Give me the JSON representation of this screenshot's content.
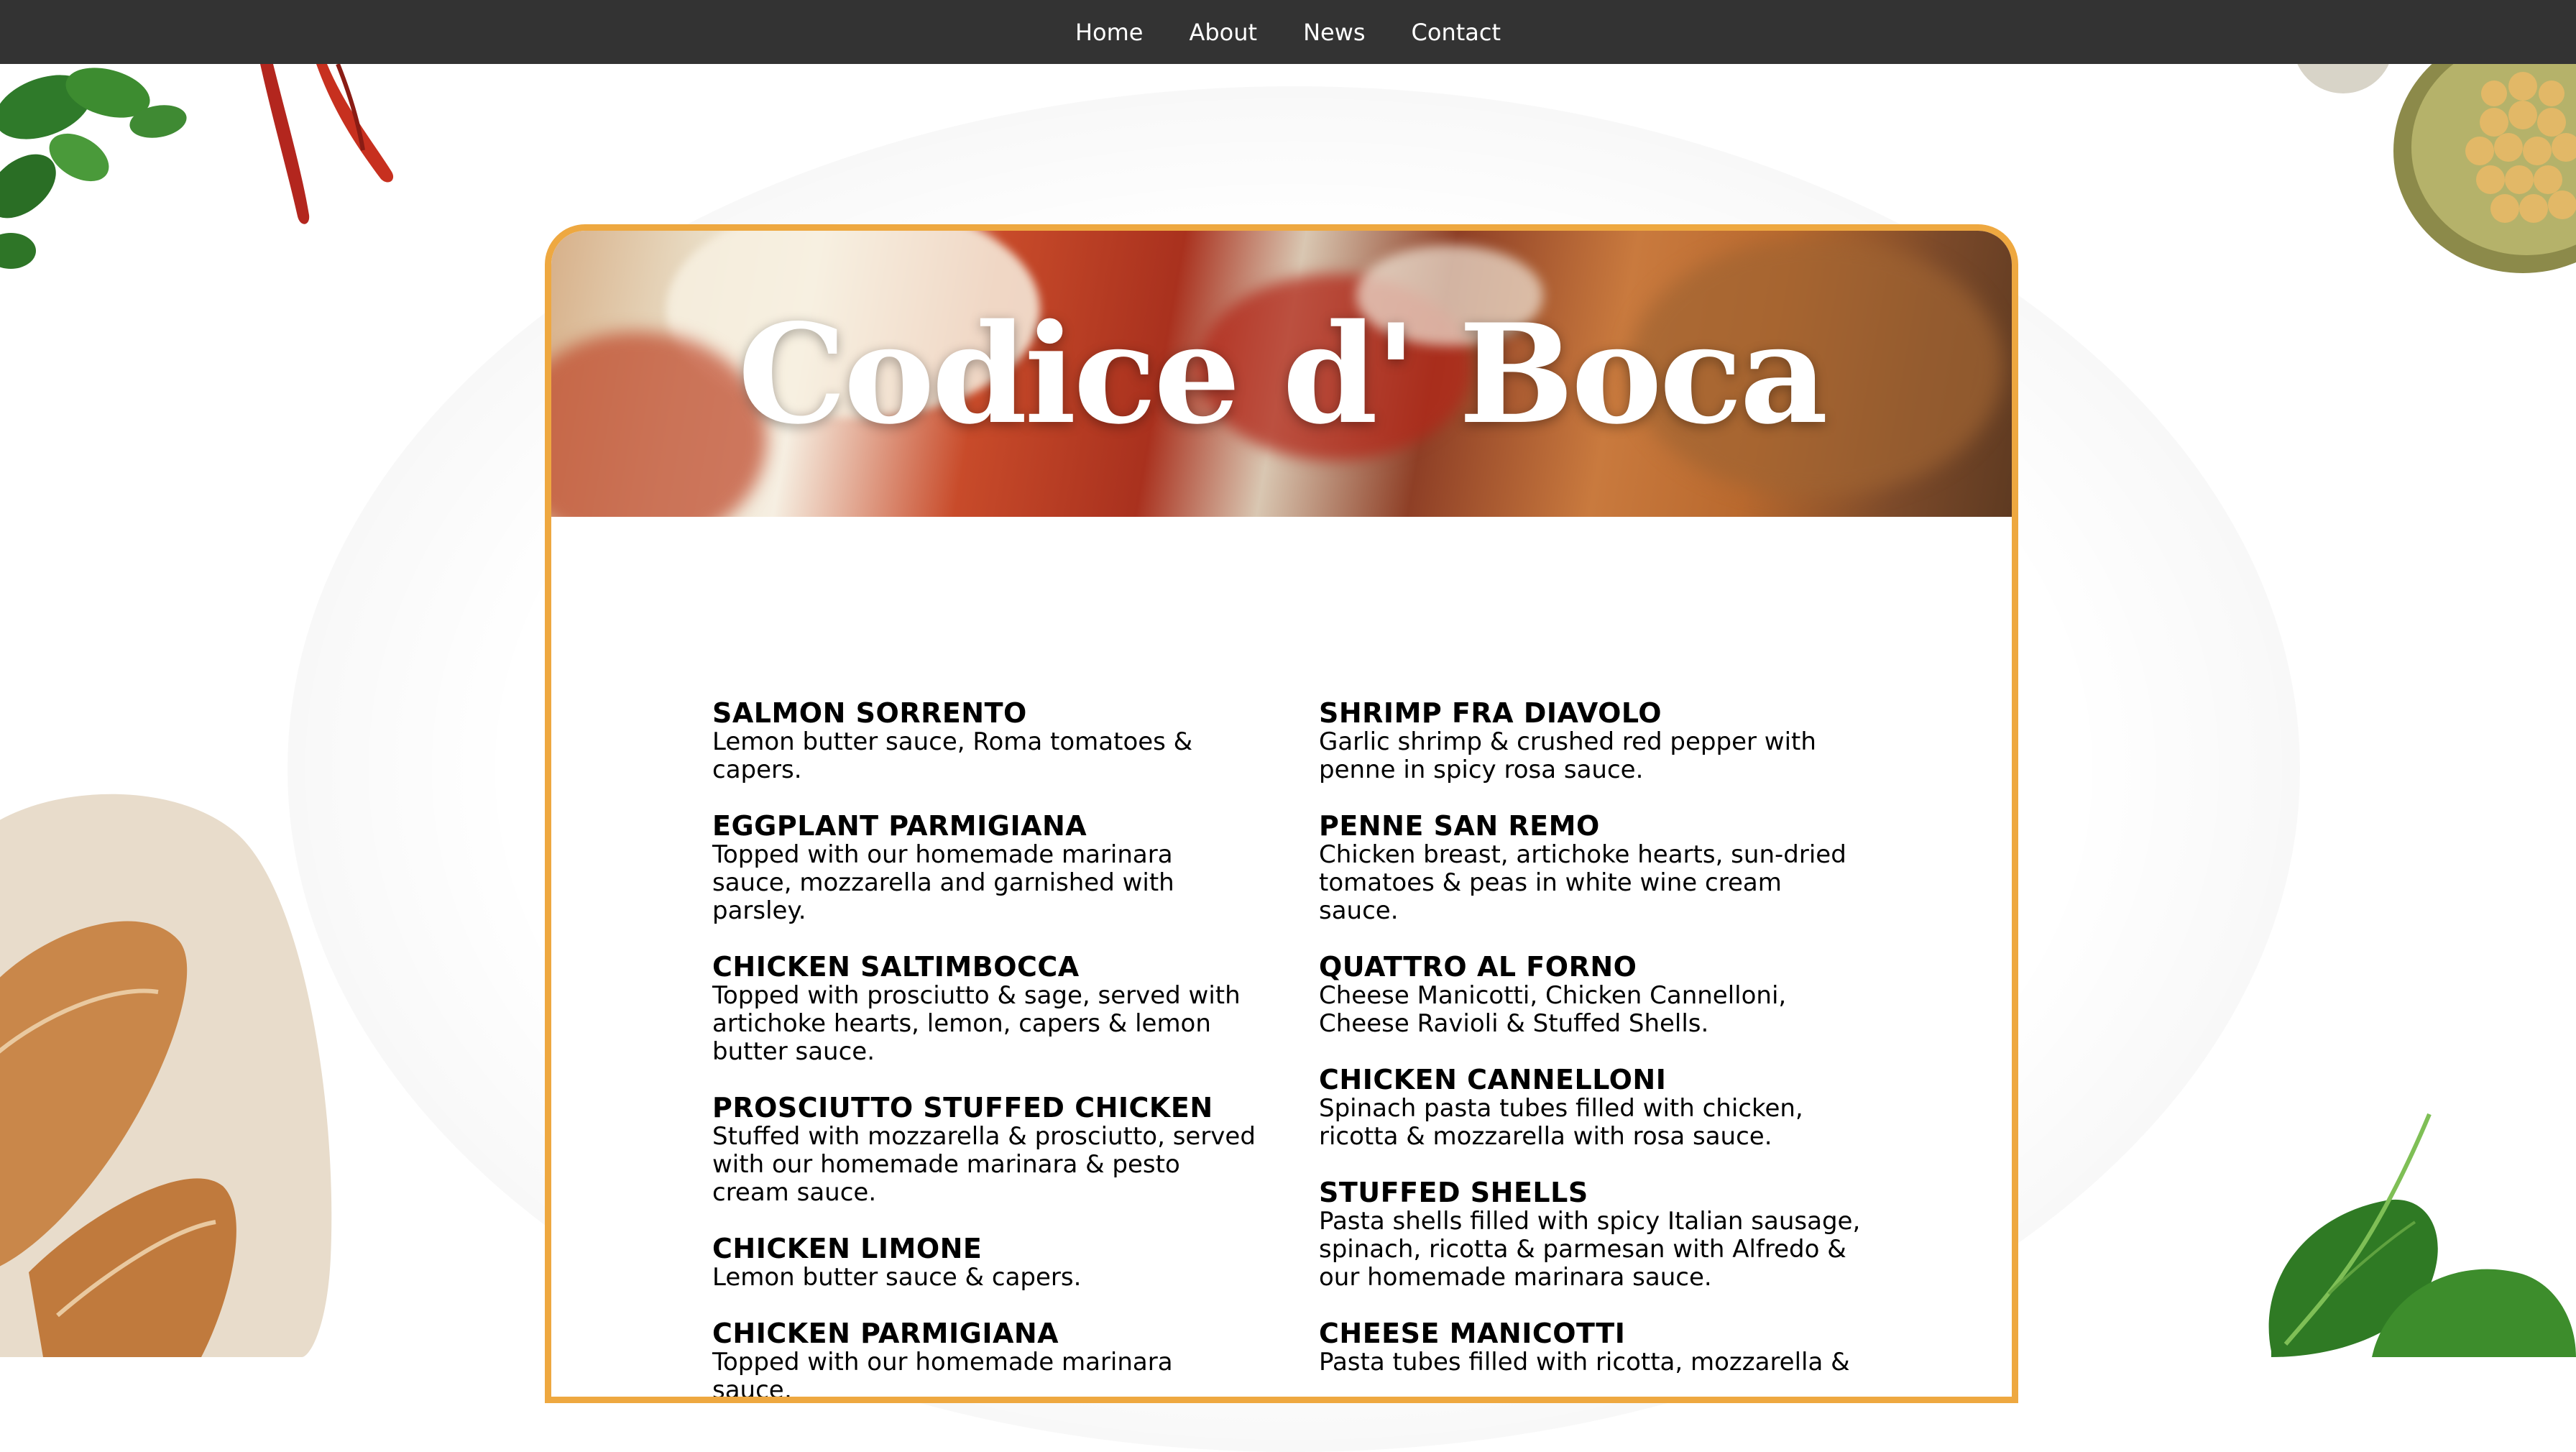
{
  "nav": {
    "items": [
      {
        "label": "Home"
      },
      {
        "label": "About"
      },
      {
        "label": "News"
      },
      {
        "label": "Contact"
      }
    ]
  },
  "restaurant": {
    "title": "Codice d' Boca"
  },
  "menu": {
    "left": [
      {
        "name": "SALMON SORRENTO",
        "desc": "Lemon butter sauce, Roma tomatoes & capers."
      },
      {
        "name": "EGGPLANT PARMIGIANA",
        "desc": "Topped with our homemade marinara sauce, mozzarella and garnished with parsley."
      },
      {
        "name": "CHICKEN SALTIMBOCCA",
        "desc": "Topped with prosciutto & sage, served with artichoke hearts, lemon, capers & lemon butter sauce."
      },
      {
        "name": "PROSCIUTTO STUFFED CHICKEN",
        "desc": "Stuffed with mozzarella & prosciutto, served with our homemade marinara & pesto cream sauce."
      },
      {
        "name": "CHICKEN LIMONE",
        "desc": "Lemon butter sauce & capers."
      },
      {
        "name": "CHICKEN PARMIGIANA",
        "desc": "Topped with our homemade marinara sauce,"
      }
    ],
    "right": [
      {
        "name": "SHRIMP FRA DIAVOLO",
        "desc": "Garlic shrimp & crushed red pepper with penne in spicy rosa sauce."
      },
      {
        "name": "PENNE SAN REMO",
        "desc": "Chicken breast, artichoke hearts, sun-dried tomatoes & peas in white wine cream sauce."
      },
      {
        "name": "QUATTRO AL FORNO",
        "desc": "Cheese Manicotti, Chicken Cannelloni, Cheese Ravioli & Stuffed Shells."
      },
      {
        "name": "CHICKEN CANNELLONI",
        "desc": "Spinach pasta tubes filled with chicken, ricotta & mozzarella with rosa sauce."
      },
      {
        "name": "STUFFED SHELLS",
        "desc": "Pasta shells filled with spicy Italian sausage, spinach, ricotta & parmesan with Alfredo & our homemade marinara sauce."
      },
      {
        "name": "CHEESE MANICOTTI",
        "desc": "Pasta tubes filled with ricotta, mozzarella &"
      }
    ]
  },
  "colors": {
    "nav_bg": "#333333",
    "card_border": "#eea840",
    "title": "#ffffff"
  },
  "decorations": {
    "top_left": "cilantro-and-chili-peppers",
    "top_right": "bowl-of-chickpeas",
    "bottom_left": "bread-loaf",
    "bottom_right": "spinach-leaves"
  }
}
